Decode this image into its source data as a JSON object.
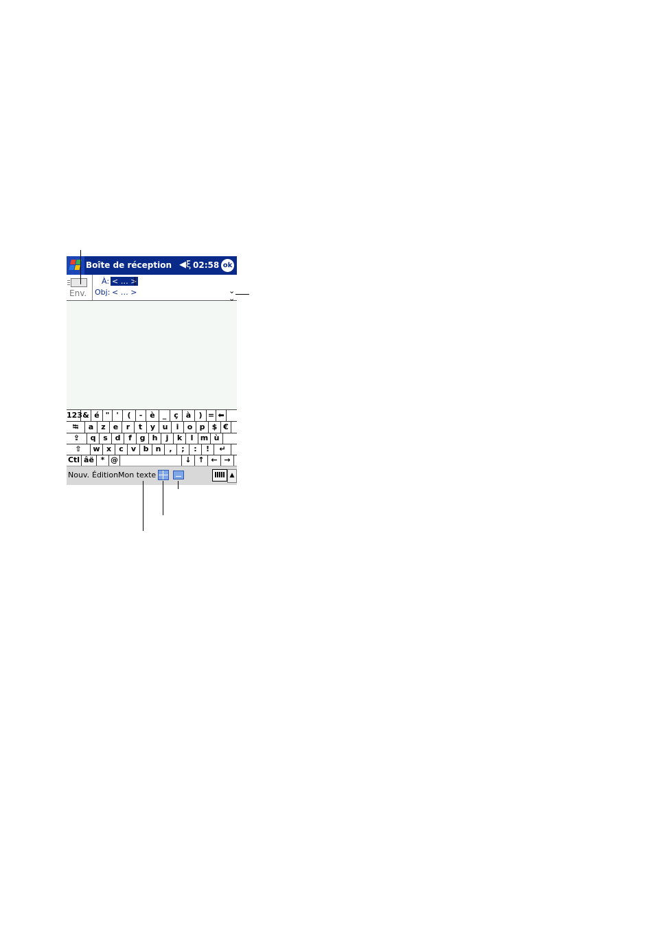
{
  "titlebar": {
    "title": "Boîte de réception",
    "speaker_icon": "◀ॡ",
    "clock": "02:58",
    "ok_label": "ok"
  },
  "header": {
    "send_label": "Env.",
    "to_label": "À:",
    "to_value": "< … >",
    "subject_label": "Obj:",
    "subject_value": "< … >",
    "expand_glyph": "¥"
  },
  "keyboard": {
    "row1": [
      "123",
      "&",
      "é",
      "\"",
      "'",
      "(",
      "-",
      "è",
      "_",
      "ç",
      "à",
      ")",
      "=",
      "⬅"
    ],
    "row2": [
      "⭾",
      "a",
      "z",
      "e",
      "r",
      "t",
      "y",
      "u",
      "i",
      "o",
      "p",
      "$",
      "€"
    ],
    "row3": [
      "⇪",
      "q",
      "s",
      "d",
      "f",
      "g",
      "h",
      "j",
      "k",
      "l",
      "m",
      "ù"
    ],
    "row4": [
      "⇧",
      "w",
      "x",
      "c",
      "v",
      "b",
      "n",
      ",",
      ";",
      ":",
      "!",
      "↵"
    ],
    "row5": [
      "Ctl",
      "âë",
      "*",
      "@",
      "",
      "↓",
      "↑",
      "←",
      "→"
    ]
  },
  "menubar": {
    "new_label": "Nouv.",
    "edit_label": "Édition",
    "mytext_label": "Mon texte",
    "sip_arrow": "▲"
  },
  "colors": {
    "titlebar": "#0a2a8a",
    "body": "#f4f8f4",
    "menubar": "#d8d8d8"
  }
}
